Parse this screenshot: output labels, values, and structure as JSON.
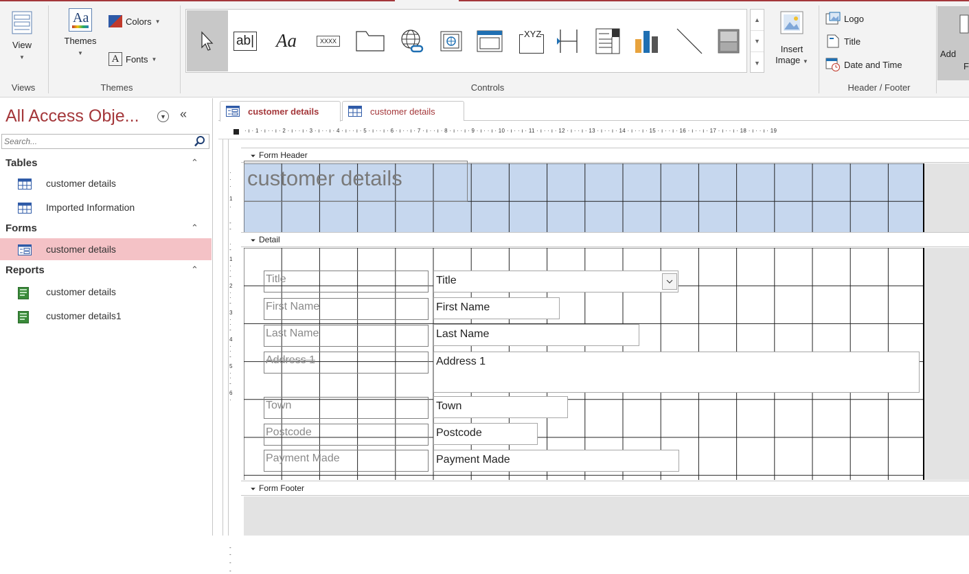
{
  "ribbon": {
    "views": {
      "view_label": "View",
      "group_label": "Views"
    },
    "themes": {
      "themes_label": "Themes",
      "colors_label": "Colors",
      "fonts_label": "Fonts",
      "group_label": "Themes",
      "themes_icon_text": "Aa"
    },
    "controls": {
      "group_label": "Controls",
      "items": [
        {
          "name": "select",
          "icon": "pointer-arrow-icon"
        },
        {
          "name": "text-box",
          "icon": "text-box-icon",
          "text": "ab|"
        },
        {
          "name": "label",
          "icon": "label-icon",
          "text": "Aa"
        },
        {
          "name": "button",
          "icon": "button-icon",
          "text": "XXXX"
        },
        {
          "name": "tab-control",
          "icon": "tab-control-icon"
        },
        {
          "name": "hyperlink",
          "icon": "hyperlink-globe-icon"
        },
        {
          "name": "web-browser",
          "icon": "web-browser-icon"
        },
        {
          "name": "navigation",
          "icon": "navigation-control-icon"
        },
        {
          "name": "option-group",
          "icon": "option-group-icon",
          "text": "XYZ"
        },
        {
          "name": "page-break",
          "icon": "page-break-icon"
        },
        {
          "name": "combo-box",
          "icon": "combo-box-icon"
        },
        {
          "name": "chart",
          "icon": "chart-icon"
        },
        {
          "name": "line",
          "icon": "line-icon"
        },
        {
          "name": "toggle",
          "icon": "toggle-button-icon"
        }
      ]
    },
    "insert_image": {
      "label_line1": "Insert",
      "label_line2": "Image"
    },
    "header_footer": {
      "logo_label": "Logo",
      "title_label": "Title",
      "date_time_label": "Date and Time",
      "group_label": "Header / Footer"
    },
    "add_existing": {
      "label_line1": "Add",
      "label_line2": "F"
    }
  },
  "nav": {
    "title": "All Access Obje...",
    "collapse_glyph": "«",
    "search_placeholder": "Search...",
    "categories": [
      {
        "label": "Tables",
        "items": [
          {
            "label": "customer details",
            "type": "table"
          },
          {
            "label": "Imported Information",
            "type": "table"
          }
        ]
      },
      {
        "label": "Forms",
        "items": [
          {
            "label": "customer details",
            "type": "form",
            "selected": true
          }
        ]
      },
      {
        "label": "Reports",
        "items": [
          {
            "label": "customer details",
            "type": "report"
          },
          {
            "label": "customer details1",
            "type": "report"
          }
        ]
      }
    ]
  },
  "tabs": [
    {
      "label": "customer details",
      "type": "form",
      "active": true
    },
    {
      "label": "customer details",
      "type": "table",
      "active": false
    }
  ],
  "ruler": {
    "h_numbers": [
      "1",
      "2",
      "3",
      "4",
      "5",
      "6",
      "7",
      "8",
      "9",
      "10",
      "11",
      "12",
      "13",
      "14",
      "15",
      "16",
      "17",
      "18",
      "19"
    ],
    "v_detail_numbers": [
      "1",
      "2",
      "3",
      "4",
      "5",
      "6"
    ],
    "v_header_numbers": [
      "1"
    ]
  },
  "sections": {
    "form_header": "Form Header",
    "detail": "Detail",
    "form_footer": "Form Footer"
  },
  "form": {
    "title": "customer details",
    "fields": [
      {
        "label": "Title",
        "control": "Title",
        "kind": "combo"
      },
      {
        "label": "First Name",
        "control": "First Name",
        "kind": "text"
      },
      {
        "label": "Last Name",
        "control": "Last Name",
        "kind": "text"
      },
      {
        "label": "Address 1",
        "control": "Address 1",
        "kind": "text"
      },
      {
        "label": "Town",
        "control": "Town",
        "kind": "text"
      },
      {
        "label": "Postcode",
        "control": "Postcode",
        "kind": "text"
      },
      {
        "label": "Payment Made",
        "control": "Payment Made",
        "kind": "text"
      }
    ]
  },
  "colors": {
    "accent": "#a4373a",
    "header_fill": "#c6d7ee",
    "selected_nav": "#f4c2c6"
  }
}
